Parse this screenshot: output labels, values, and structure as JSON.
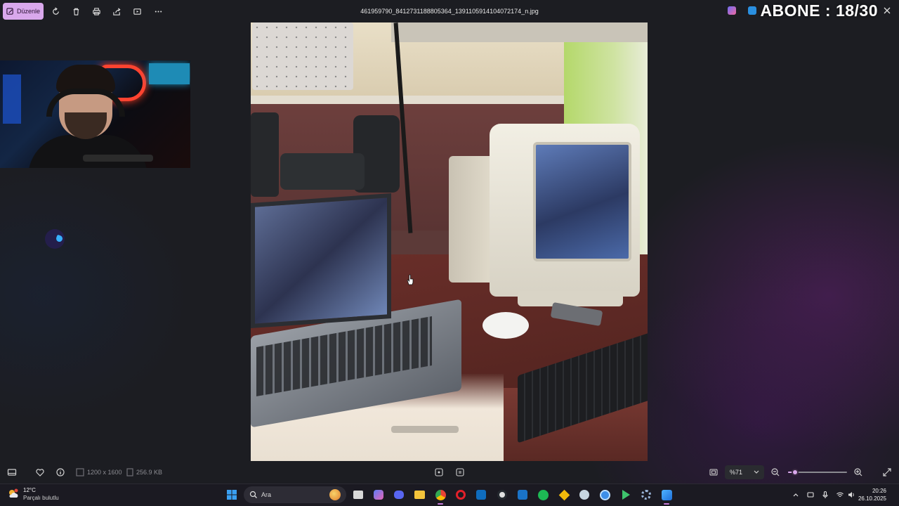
{
  "toolbar": {
    "edit_label": "Düzenle",
    "buttons": [
      {
        "name": "rotate-icon"
      },
      {
        "name": "delete-icon"
      },
      {
        "name": "print-icon"
      },
      {
        "name": "share-icon"
      },
      {
        "name": "slideshow-icon"
      },
      {
        "name": "more-icon"
      }
    ]
  },
  "window": {
    "filename": "461959790_8412731188805364_1391105914104072174_n.jpg"
  },
  "overlay": {
    "abone_text": "ABONE : 18/30"
  },
  "image_info": {
    "dimensions": "1200 x 1600",
    "file_size": "256.9 KB"
  },
  "zoom": {
    "value": "%71",
    "level": 0.12
  },
  "taskbar": {
    "weather_temp": "12°C",
    "weather_desc": "Parçalı bulutlu",
    "search_label": "Ara",
    "apps": [
      "start-icon",
      "search-icon",
      "file-explorer-icon",
      "copilot-icon",
      "discord-icon",
      "folder-icon",
      "chrome-icon",
      "opera-icon",
      "outlook-icon",
      "github-icon",
      "outlook-mail-icon",
      "spotify-icon",
      "binance-icon",
      "steam-icon",
      "app-icon",
      "media-icon",
      "settings-icon",
      "photos-icon"
    ],
    "time": "20:26",
    "date": "26.10.2025"
  },
  "colors": {
    "accent": "#d9a8ec",
    "background": "#1c1d22",
    "taskbar": "#1b1a22"
  }
}
